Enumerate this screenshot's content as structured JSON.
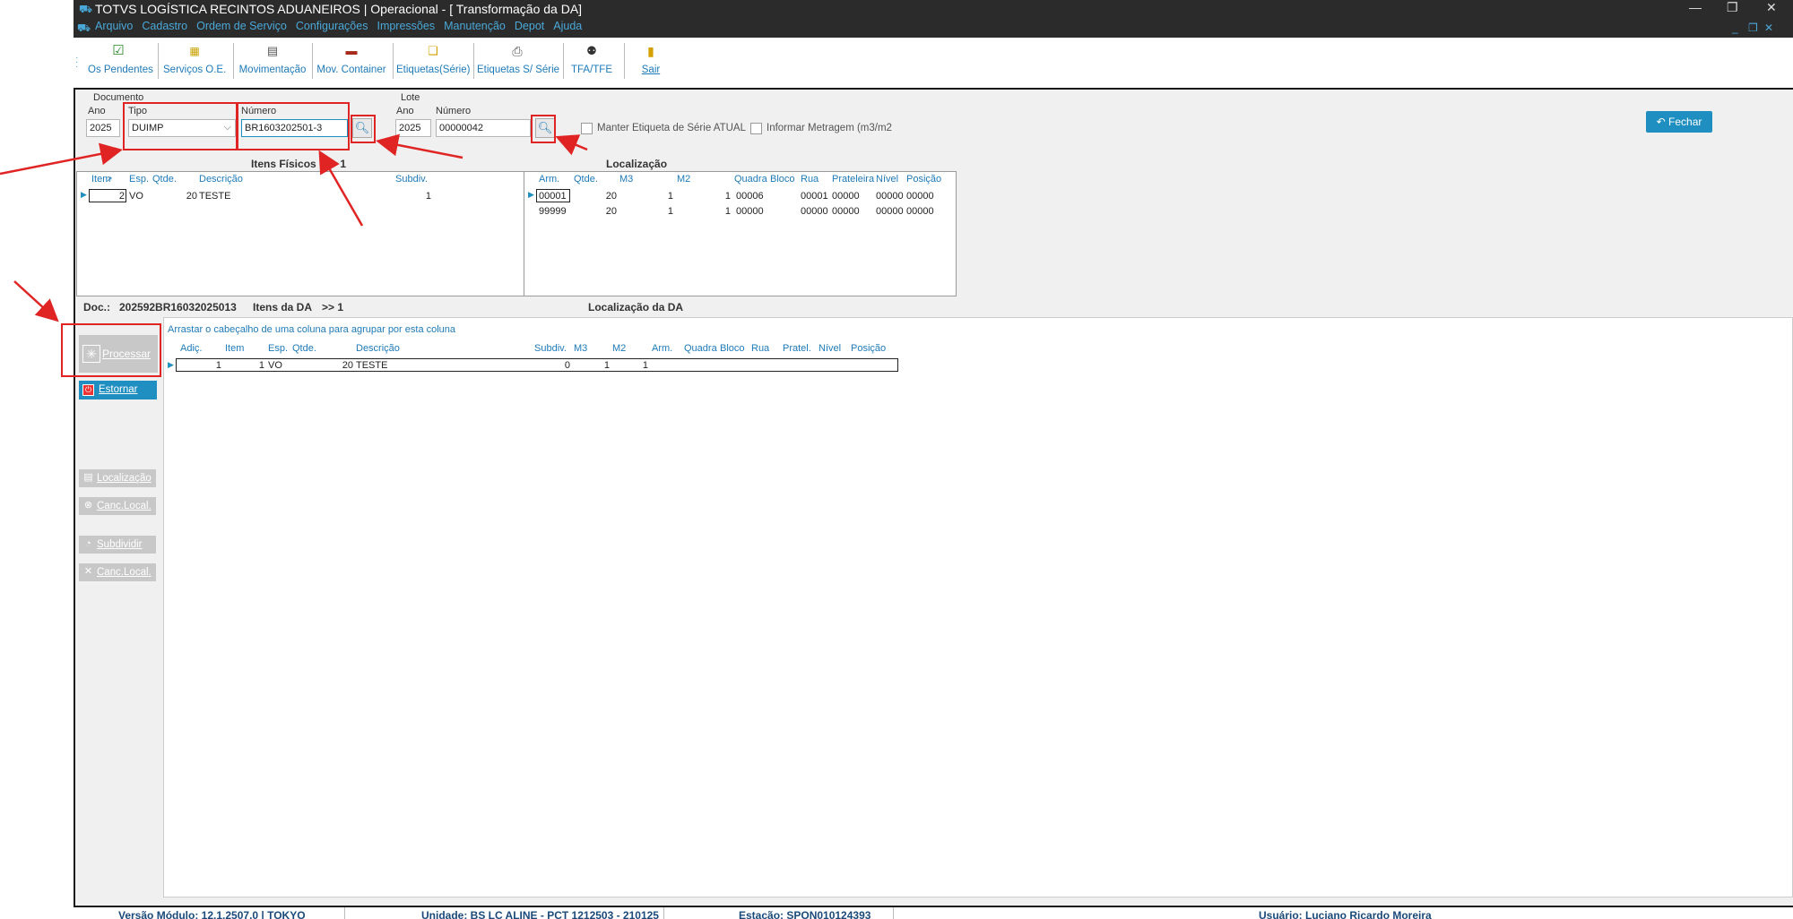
{
  "window": {
    "title": "TOTVS LOGÍSTICA RECINTOS ADUANEIROS | Operacional - [ Transformação da DA]"
  },
  "menu": [
    "Arquivo",
    "Cadastro",
    "Ordem de Serviço",
    "Configurações",
    "Impressões",
    "Manutenção",
    "Depot",
    "Ajuda"
  ],
  "toolbar": {
    "os_pendentes": "Os Pendentes",
    "servicos_oe": "Serviços O.E.",
    "movimentacao": "Movimentação",
    "mov_container": "Mov. Container",
    "etiquetas_serie": "Etiquetas(Série)",
    "etiquetas_s_serie": "Etiquetas S/ Série",
    "tfa_tfe": "TFA/TFE",
    "sair": "Sair"
  },
  "documento": {
    "group_label": "Documento",
    "ano_label": "Ano",
    "ano_value": "2025",
    "tipo_label": "Tipo",
    "tipo_value": "DUIMP",
    "numero_label": "Número",
    "numero_value": "BR1603202501-3"
  },
  "lote": {
    "group_label": "Lote",
    "ano_label": "Ano",
    "ano_value": "2025",
    "numero_label": "Número",
    "numero_value": "00000042"
  },
  "options": {
    "manter_etiqueta": "Manter Etiqueta de Série ATUAL",
    "informar_metragem": "Informar Metragem (m3/m2"
  },
  "fechar_label": "Fechar",
  "itens_fisicos": {
    "title": "Itens Físicos",
    "count": ">> 1",
    "headers": [
      "Item",
      "Esp.",
      "Qtde.",
      "Descrição",
      "Subdiv."
    ],
    "rows": [
      [
        "2",
        "VO",
        "20",
        "TESTE",
        "1"
      ]
    ]
  },
  "localizacao": {
    "title": "Localização",
    "headers": [
      "Arm.",
      "Qtde.",
      "M3",
      "M2",
      "Quadra",
      "Bloco",
      "Rua",
      "Prateleira",
      "Nível",
      "Posição"
    ],
    "rows": [
      [
        "00001",
        "20",
        "1",
        "1",
        "00006",
        "",
        "00001",
        "00000",
        "00000",
        "00000"
      ],
      [
        "99999",
        "20",
        "1",
        "1",
        "00000",
        "",
        "00000",
        "00000",
        "00000",
        "00000"
      ]
    ]
  },
  "doc_line": {
    "doc_label": "Doc.:",
    "doc_value": "202592BR16032025013",
    "itens_da": "Itens da DA",
    "count": ">> 1",
    "localizacao_da": "Localização da DA"
  },
  "itens_da_grid": {
    "group_hint": "Arrastar o cabeçalho de uma coluna para agrupar por esta coluna",
    "headers": [
      "Adiç.",
      "Item",
      "Esp.",
      "Qtde.",
      "Descrição",
      "Subdiv.",
      "M3",
      "M2",
      "Arm.",
      "Quadra",
      "Bloco",
      "Rua",
      "Pratel.",
      "Nível",
      "Posição"
    ],
    "rows": [
      [
        "1",
        "1",
        "VO",
        "20",
        "TESTE",
        "0",
        "1",
        "1",
        "",
        "",
        "",
        "",
        "",
        "",
        ""
      ]
    ]
  },
  "side_buttons": {
    "processar": "Processar",
    "estornar": "Estornar",
    "localizacao": "Localização",
    "canc_local_1": "Canc.Local.",
    "subdividir": "Subdividir",
    "canc_local_2": "Canc.Local."
  },
  "status": {
    "versao": "Versão Módulo:  12.1.2507.0  |  TOKYO",
    "unidade": "Unidade: BS LC ALINE - PCT 1212503 - 210125",
    "estacao": "Estação: SPON010124393",
    "usuario": "Usuário: Luciano Ricardo Moreira"
  },
  "colors": {
    "accent": "#1e8fc0",
    "annotation": "#e02424",
    "titlebar": "#2b2b2b"
  }
}
